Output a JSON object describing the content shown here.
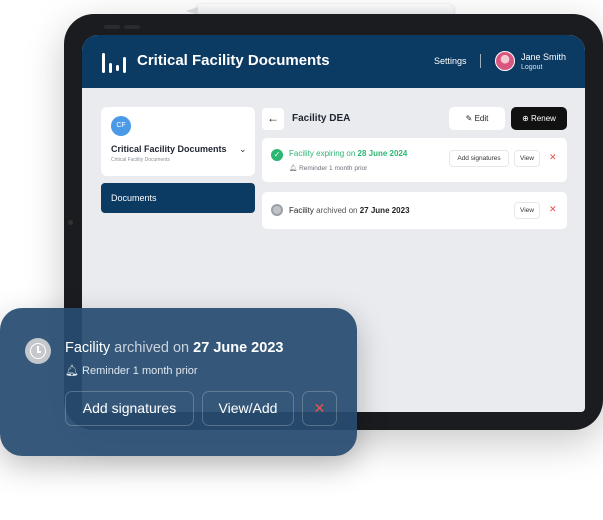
{
  "app": {
    "title": "Critical Facility Documents",
    "settings_label": "Settings",
    "user_name": "Jane Smith",
    "logout_label": "Logout"
  },
  "sidebar": {
    "folder_initials": "CF",
    "folder_title": "Critical Facility Documents",
    "folder_subtitle": "Critical Facility Documents",
    "chevron": "⌄",
    "nav_documents": "Documents"
  },
  "main": {
    "back_icon": "←",
    "title": "Facility DEA",
    "edit_label": "Edit",
    "renew_label": "Renew",
    "documents": [
      {
        "name": "Facility",
        "status_text": "expiring on",
        "date": "28 June 2024",
        "reminder": "Reminder 1 month prior",
        "add_signatures_label": "Add signatures",
        "view_label": "View",
        "remove_icon": "✕"
      },
      {
        "name": "Facility",
        "status_text": "archived on",
        "date": "27 June 2023",
        "view_label": "View",
        "remove_icon": "✕"
      }
    ]
  },
  "overlay": {
    "name": "Facility",
    "status_text": "archived on",
    "date": "27 June 2023",
    "reminder": "Reminder 1 month prior",
    "add_signatures_label": "Add signatures",
    "view_add_label": "View/Add",
    "remove_icon": "✕"
  },
  "colors": {
    "header_bg": "#0b3a63",
    "status_green": "#2bb673",
    "remove_red": "#e54b4b",
    "overlay_bg": "#274c71"
  }
}
